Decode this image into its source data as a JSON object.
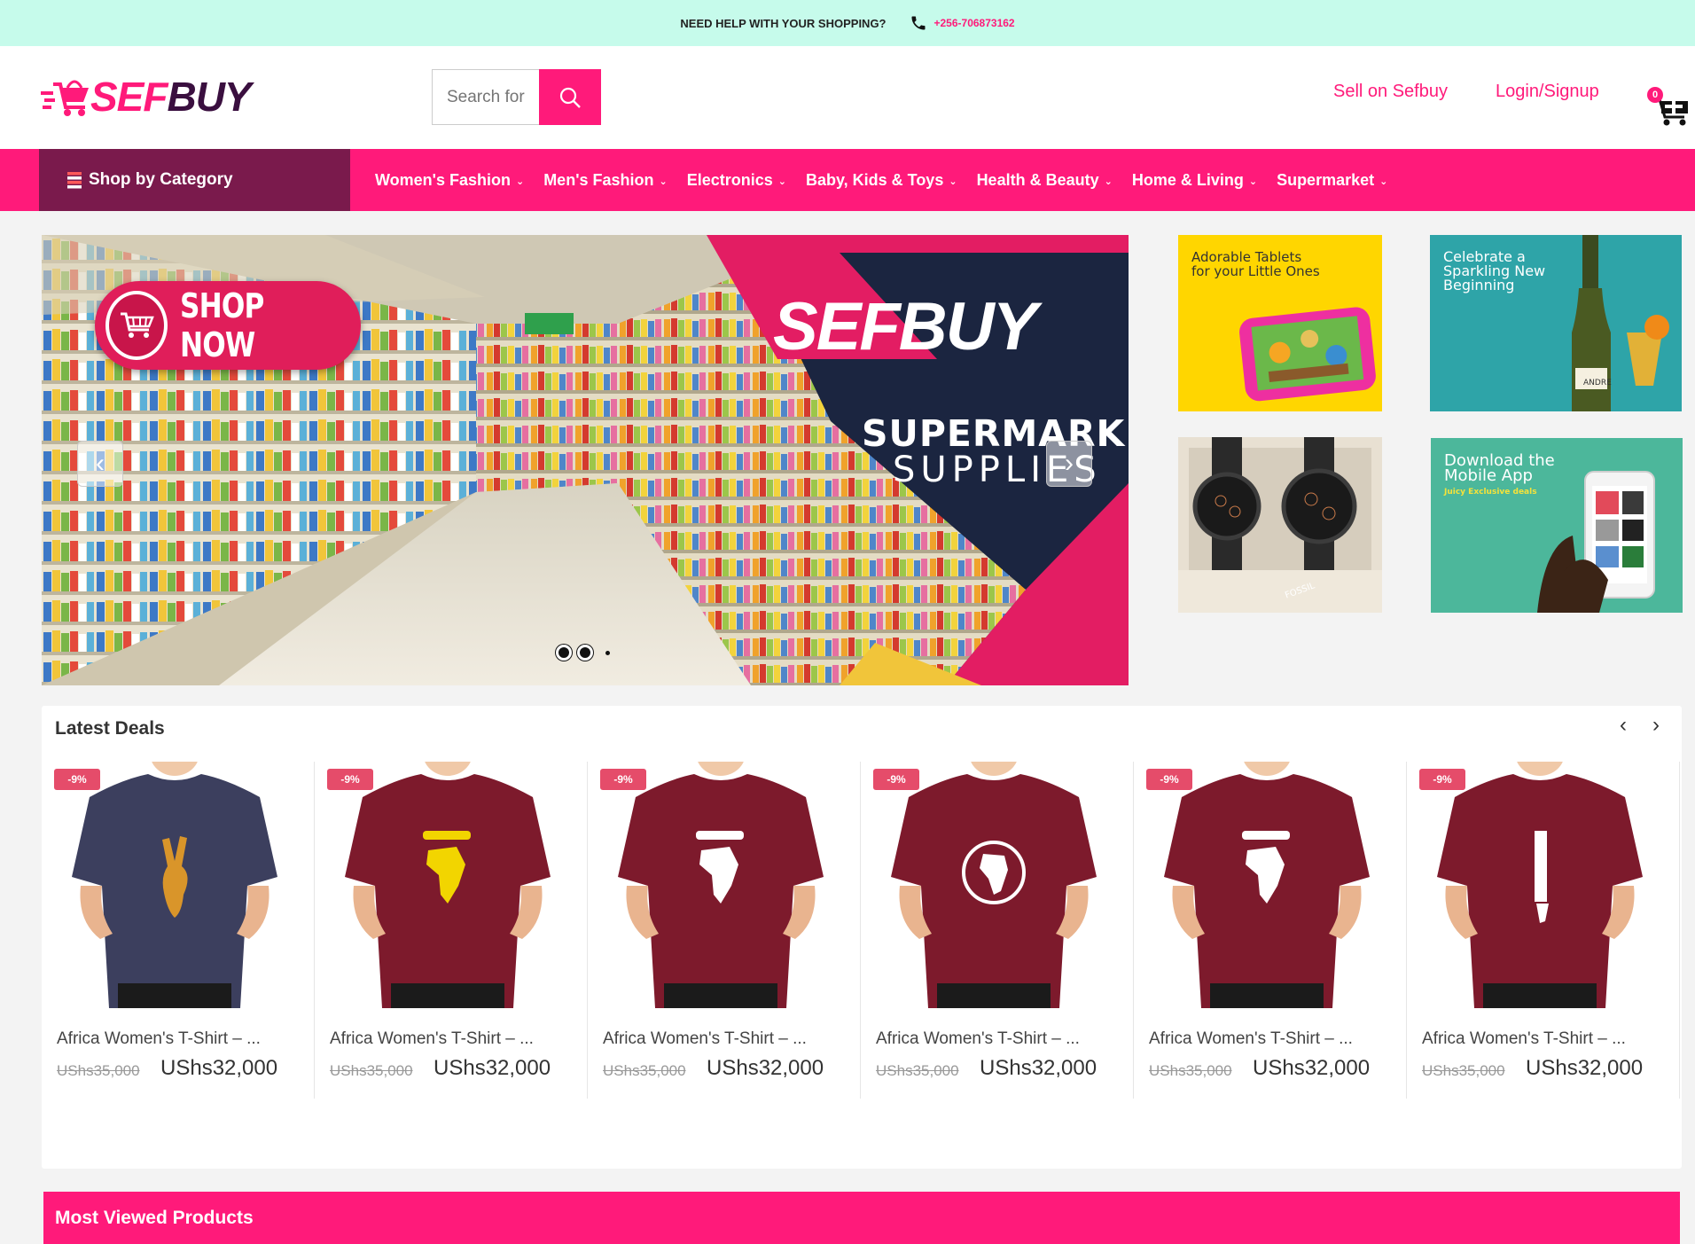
{
  "topbar": {
    "help_text": "NEED HELP WITH YOUR SHOPPING?",
    "phone": "+256-706873162"
  },
  "header": {
    "logo_part1": "SEF",
    "logo_part2": "BUY",
    "search_placeholder": "Search for",
    "sell_link": "Sell on Sefbuy",
    "login_link": "Login/Signup",
    "cart_count": "0"
  },
  "nav": {
    "category_label": "Shop by Category",
    "items": [
      {
        "label": "Women's Fashion"
      },
      {
        "label": "Men's Fashion"
      },
      {
        "label": "Electronics"
      },
      {
        "label": "Baby, Kids & Toys"
      },
      {
        "label": "Health & Beauty"
      },
      {
        "label": "Home & Living"
      },
      {
        "label": "Supermarket"
      }
    ]
  },
  "hero": {
    "shop_now": "SHOP NOW",
    "brand": "SEFBUY",
    "headline1": "SUPERMARKET",
    "headline2": "SUPPLIES",
    "active_slide": 1,
    "slide_count": 3
  },
  "promos": {
    "tablets": {
      "line1": "Adorable Tablets",
      "line2": "for your Little Ones"
    },
    "celebrate": {
      "line1": "Celebrate a",
      "line2": "Sparkling New",
      "line3": "Beginning",
      "bottle_label": "ANDRE"
    },
    "watches": {
      "brand": "FOSSIL"
    },
    "app": {
      "line1": "Download the",
      "line2": "Mobile App",
      "line3": "Juicy Exclusive deals"
    }
  },
  "deals": {
    "title": "Latest Deals",
    "products": [
      {
        "discount": "-9%",
        "name": "Africa Women's T-Shirt – ...",
        "old_price": "UShs35,000",
        "price": "UShs32,000",
        "shirt_color": "#3c3f5e",
        "print": "peace",
        "print_color": "#d9952a"
      },
      {
        "discount": "-9%",
        "name": "Africa Women's T-Shirt – ...",
        "old_price": "UShs35,000",
        "price": "UShs32,000",
        "shirt_color": "#7d1a2c",
        "print": "Africa",
        "print_color": "#f2d500"
      },
      {
        "discount": "-9%",
        "name": "Africa Women's T-Shirt – ...",
        "old_price": "UShs35,000",
        "price": "UShs32,000",
        "shirt_color": "#7d1a2c",
        "print": "Africa",
        "print_color": "#ffffff"
      },
      {
        "discount": "-9%",
        "name": "Africa Women's T-Shirt – ...",
        "old_price": "UShs35,000",
        "price": "UShs32,000",
        "shirt_color": "#7d1a2c",
        "print": "circle",
        "print_color": "#ffffff"
      },
      {
        "discount": "-9%",
        "name": "Africa Women's T-Shirt – ...",
        "old_price": "UShs35,000",
        "price": "UShs32,000",
        "shirt_color": "#7d1a2c",
        "print": "AFRICA",
        "print_color": "#ffffff"
      },
      {
        "discount": "-9%",
        "name": "Africa Women's T-Shirt – ...",
        "old_price": "UShs35,000",
        "price": "UShs32,000",
        "shirt_color": "#7d1a2c",
        "print": "vertical",
        "print_color": "#ffffff"
      }
    ]
  },
  "most_viewed": {
    "title": "Most Viewed Products"
  },
  "colors": {
    "brand_pink": "#ff1a7a",
    "brand_plum": "#7a1a4c",
    "topbar": "#c6fbeb"
  }
}
